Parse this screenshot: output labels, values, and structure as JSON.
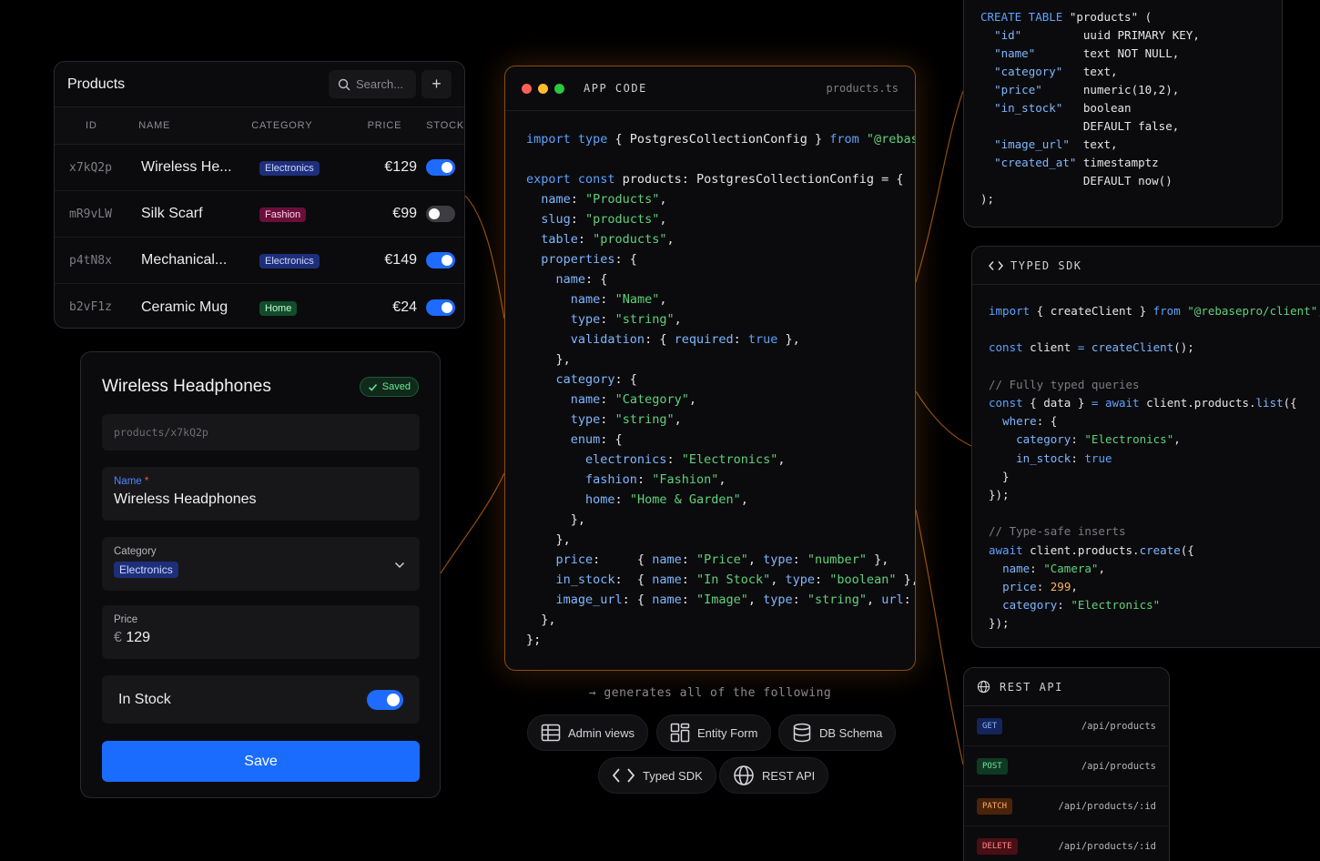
{
  "products_table": {
    "title": "Products",
    "search_placeholder": "Search...",
    "add_label": "+",
    "columns": [
      "ID",
      "NAME",
      "CATEGORY",
      "PRICE",
      "STOCK"
    ],
    "rows": [
      {
        "id": "x7kQ2p",
        "name": "Wireless He...",
        "category": "Electronics",
        "category_color": "blue",
        "price": "€129",
        "in_stock": true
      },
      {
        "id": "mR9vLW",
        "name": "Silk Scarf",
        "category": "Fashion",
        "category_color": "pink",
        "price": "€99",
        "in_stock": false
      },
      {
        "id": "p4tN8x",
        "name": "Mechanical...",
        "category": "Electronics",
        "category_color": "blue",
        "price": "€149",
        "in_stock": true
      },
      {
        "id": "b2vF1z",
        "name": "Ceramic Mug",
        "category": "Home",
        "category_color": "green",
        "price": "€24",
        "in_stock": true
      }
    ]
  },
  "form": {
    "title": "Wireless Headphones",
    "saved_label": "Saved",
    "path": "products/x7kQ2p",
    "name_label": "Name",
    "name_required": "*",
    "name_value": "Wireless Headphones",
    "category_label": "Category",
    "category_value": "Electronics",
    "price_label": "Price",
    "price_currency": "€",
    "price_value": "129",
    "stock_label": "In Stock",
    "stock_on": true,
    "save_label": "Save"
  },
  "app_code": {
    "title": "APP CODE",
    "filename": "products.ts"
  },
  "typed_sdk": {
    "title": "TYPED SDK"
  },
  "rest_api": {
    "title": "REST API",
    "endpoints": [
      {
        "method": "GET",
        "path": "/api/products"
      },
      {
        "method": "POST",
        "path": "/api/products"
      },
      {
        "method": "PATCH",
        "path": "/api/products/:id"
      },
      {
        "method": "DELETE",
        "path": "/api/products/:id"
      }
    ]
  },
  "generates": {
    "caption": "→ generates all of the following",
    "items": [
      "Admin views",
      "Entity Form",
      "DB Schema",
      "Typed SDK",
      "REST API"
    ]
  },
  "colors": {
    "accent": "#1a6cff",
    "glow": "#ff8c28",
    "string": "#5fd17a",
    "keyword": "#5ea2ff"
  }
}
